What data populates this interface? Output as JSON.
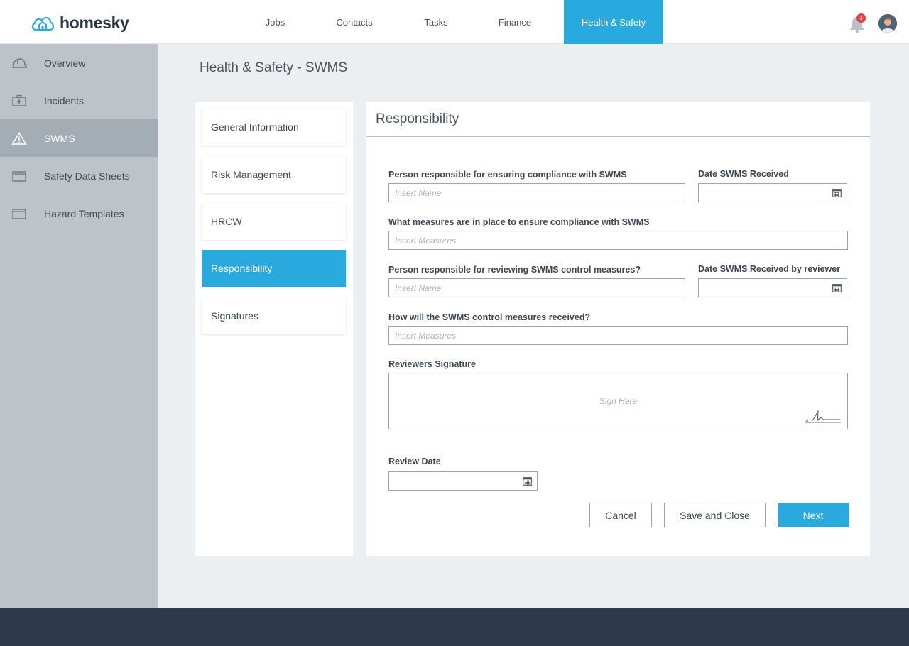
{
  "brand": {
    "name": "homesky",
    "accent": "#29aadf"
  },
  "nav": {
    "items": [
      "Jobs",
      "Contacts",
      "Tasks",
      "Finance",
      "Health & Safety"
    ],
    "active": "Health & Safety"
  },
  "notifications": {
    "count": "3",
    "icon": "bell-icon"
  },
  "sidebar": {
    "items": [
      {
        "label": "Overview",
        "icon": "helmet-icon"
      },
      {
        "label": "Incidents",
        "icon": "first-aid-kit-icon"
      },
      {
        "label": "SWMS",
        "icon": "warning-triangle-icon"
      },
      {
        "label": "Safety Data Sheets",
        "icon": "folder-icon"
      },
      {
        "label": "Hazard Templates",
        "icon": "folder-icon"
      }
    ],
    "active": "SWMS"
  },
  "page": {
    "title": "Health & Safety - SWMS"
  },
  "steps": [
    "General Information",
    "Risk Management",
    "HRCW",
    "Responsibility",
    "Signatures"
  ],
  "form": {
    "title": "Responsibility",
    "compliance_person": {
      "label": "Person responsible for ensuring compliance with SWMS",
      "placeholder": "Insert Name"
    },
    "date_received": {
      "label": "Date SWMS Received",
      "value": ""
    },
    "measures": {
      "label": "What measures are in place to ensure compliance with SWMS",
      "placeholder": "Insert Measures"
    },
    "reviewer_person": {
      "label": "Person responsible for reviewing SWMS control measures?",
      "placeholder": "Insert Name"
    },
    "date_received_reviewer": {
      "label": "Date SWMS Received by reviewer",
      "value": ""
    },
    "control_measures": {
      "label": "How will the SWMS control measures received?",
      "placeholder": "Insert Measures"
    },
    "signature": {
      "label": "Reviewers Signature",
      "placeholder": "Sign Here"
    },
    "review_date": {
      "label": "Review Date",
      "value": ""
    }
  },
  "actions": {
    "cancel": "Cancel",
    "save_close": "Save and Close",
    "next": "Next"
  }
}
